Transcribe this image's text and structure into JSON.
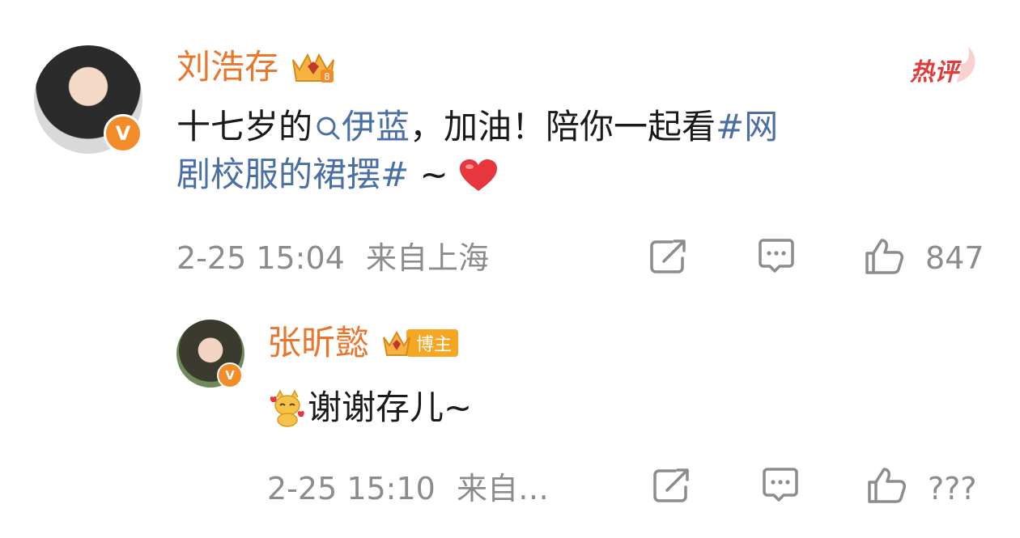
{
  "comment": {
    "username": "刘浩存",
    "badge_icon": "crown-level-8-icon",
    "hot_label": "热评",
    "text_part1": "十七岁的",
    "mention": "伊蓝",
    "text_part2": "，加油！陪你一起看",
    "hashtag_part1": "#网",
    "hashtag_part2": "剧校服的裙摆#",
    "text_tail": " ~",
    "emoji": "heart",
    "timestamp": "2-25 15:04",
    "location": "来自上海",
    "like_count": "847"
  },
  "reply": {
    "username": "张昕懿",
    "badge_label": "博主",
    "text": "谢谢存儿~",
    "emoji": "cat-sticker",
    "timestamp": "2-25 15:10",
    "location": "来自…",
    "like_count": "???"
  },
  "colors": {
    "username": "#e8762c",
    "link": "#4a6fa5",
    "meta": "#8c8c8c",
    "hot": "#e03c3c"
  }
}
